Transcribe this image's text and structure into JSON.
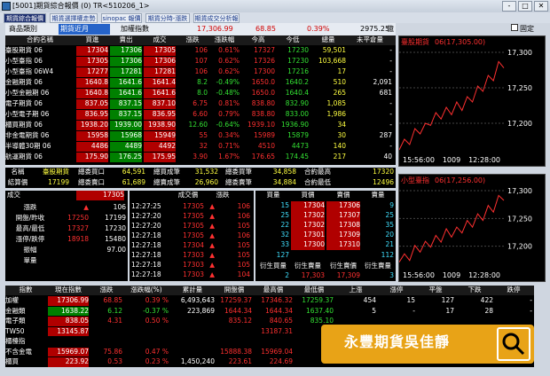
{
  "window": {
    "title": "[5001]期貨綜合報價 (0) TR<510206_1>",
    "btns": [
      "-",
      "□",
      "✕"
    ]
  },
  "tabs": [
    "期貨綜合報價",
    "期貨選擇權走勢",
    "sinopac 報價",
    "期貨分時-漲跌",
    "期貨成交分析報價"
  ],
  "toolbar": {
    "type_label": "商品類別",
    "type_value": "期貨近月",
    "idx_label": "加權指數",
    "idx_value": "17,306.99",
    "idx_chg": "68.85",
    "idx_pct": "0.39%",
    "vol": "2975.25",
    "unit": "億",
    "pin_label": "固定"
  },
  "quote_headers": [
    "合約名稱",
    "買進",
    "賣出",
    "成交",
    "漲跌",
    "漲跌幅",
    "今高",
    "今低",
    "總量",
    "未平倉量"
  ],
  "quotes": [
    [
      "臺股期貨 06",
      "17304",
      "17306",
      "17305",
      "106",
      "0.61%",
      "17327",
      "17230",
      "59,501",
      "-"
    ],
    [
      "小型臺指 06",
      "17305",
      "17306",
      "17306",
      "107",
      "0.62%",
      "17326",
      "17230",
      "103,668",
      "-"
    ],
    [
      "小型臺指 06W4",
      "17277",
      "17281",
      "17281",
      "106",
      "0.62%",
      "17300",
      "17216",
      "17",
      "-"
    ],
    [
      "金融期貨 06",
      "1640.8",
      "1641.6",
      "1641.4",
      "8.2",
      "-0.49%",
      "1650.0",
      "1640.2",
      "510",
      "2,091"
    ],
    [
      "小型金融期 06",
      "1640.8",
      "1641.6",
      "1641.6",
      "8.0",
      "-0.48%",
      "1650.0",
      "1640.4",
      "265",
      "681"
    ],
    [
      "電子期貨 06",
      "837.05",
      "837.15",
      "837.10",
      "6.75",
      "0.81%",
      "838.80",
      "832.90",
      "1,085",
      "-"
    ],
    [
      "小型電子期 06",
      "836.95",
      "837.15",
      "836.95",
      "6.60",
      "0.79%",
      "838.80",
      "833.00",
      "1,986",
      "-"
    ],
    [
      "櫃買期貨 06",
      "1938.20",
      "1939.00",
      "1938.90",
      "12.60",
      "-0.64%",
      "1939.10",
      "1936.90",
      "34",
      "-"
    ],
    [
      "非金電期貨 06",
      "15958",
      "15968",
      "15949",
      "55",
      "0.34%",
      "15989",
      "15879",
      "30",
      "287"
    ],
    [
      "半導體30期 06",
      "4486",
      "4489",
      "4492",
      "32",
      "0.71%",
      "4510",
      "4473",
      "140",
      "-"
    ],
    [
      "航運期貨 06",
      "175.90",
      "176.25",
      "175.95",
      "3.90",
      "1.67%",
      "176.65",
      "174.45",
      "217",
      "40"
    ]
  ],
  "summary": [
    [
      "名稱",
      "臺股期貨",
      "總委買口",
      "64,591",
      "總買成筆",
      "31,532",
      "總委買筆",
      "34,858",
      "合約最高",
      "17320"
    ],
    [
      "結算價",
      "17199",
      "總委賣口",
      "61,689",
      "總賣成筆",
      "26,960",
      "總委賣筆",
      "34,884",
      "合約最低",
      "12496"
    ]
  ],
  "left_detail": {
    "title": "成交",
    "val": "17305",
    "rows": [
      [
        "漲跌",
        "▲",
        "106"
      ],
      [
        "開盤/昨收",
        "17250",
        "17199"
      ],
      [
        "最高/最低",
        "17327",
        "17230"
      ],
      [
        "漲停/跌停",
        "18918",
        "15480"
      ],
      [
        "振幅",
        "",
        "97.00"
      ],
      [
        "單量",
        "",
        ""
      ]
    ]
  },
  "ticks": {
    "hdr": [
      "成交價",
      "漲跌",
      ""
    ],
    "rows": [
      [
        "12:27:25",
        "17305",
        "▲",
        "106"
      ],
      [
        "12:27:20",
        "17305",
        "▲",
        "106"
      ],
      [
        "12:27:20",
        "17305",
        "▲",
        "105"
      ],
      [
        "12:27:18",
        "17305",
        "▲",
        "106"
      ],
      [
        "12:27:18",
        "17304",
        "▲",
        "105"
      ],
      [
        "12:27:18",
        "17303",
        "▲",
        "105"
      ],
      [
        "12:27:18",
        "17303",
        "▲",
        "105"
      ],
      [
        "12:27:18",
        "17303",
        "▲",
        "104"
      ]
    ]
  },
  "book": {
    "hdr": [
      "買量",
      "買價",
      "賣價",
      "賣量"
    ],
    "rows": [
      [
        "15",
        "17304",
        "17306",
        "9"
      ],
      [
        "25",
        "17302",
        "17307",
        "25"
      ],
      [
        "22",
        "17302",
        "17308",
        "35"
      ],
      [
        "32",
        "17301",
        "17309",
        "20"
      ],
      [
        "33",
        "17300",
        "17310",
        "21"
      ]
    ],
    "totals": [
      "127",
      "112"
    ],
    "labels": [
      "衍生買量",
      "衍生賣量",
      "衍生賣價",
      "衍生賣量"
    ],
    "vals": [
      "2",
      "17,303",
      "17,309",
      "3"
    ]
  },
  "index_headers": [
    "指數",
    "現在指數",
    "漲跌",
    "漲跌幅(%)",
    "累計量",
    "開盤價",
    "最高價",
    "最低價",
    "上漲",
    "漲停",
    "平盤",
    "下跌",
    "跌停"
  ],
  "indices": [
    [
      "加權",
      "17306.99",
      "68.85",
      "0.39 %",
      "6,493,643",
      "17259.37",
      "17346.32",
      "17259.37",
      "454",
      "15",
      "127",
      "422",
      "-"
    ],
    [
      "金融類",
      "1638.22",
      "6.12",
      "-0.37 %",
      "223,869",
      "1644.34",
      "1644.34",
      "1637.40",
      "5",
      "-",
      "17",
      "28",
      "-"
    ],
    [
      "電子類",
      "838.05",
      "4.31",
      "0.50 %",
      "",
      "835.12",
      "840.65",
      "835.10",
      "",
      "",
      "",
      "",
      ""
    ],
    [
      "TW50",
      "13145.87",
      "",
      "",
      "",
      "",
      "13187.31",
      "",
      "",
      "",
      "",
      "",
      ""
    ],
    [
      "櫃檯指",
      "",
      "",
      "",
      "",
      "",
      "",
      "",
      "",
      "",
      "",
      "",
      ""
    ],
    [
      "不含金電",
      "15969.07",
      "75.86",
      "0.47 %",
      "",
      "15888.38",
      "15969.04",
      "",
      "",
      "",
      "",
      "",
      ""
    ],
    [
      "櫃買",
      "223.92",
      "0.53",
      "0.23 %",
      "1,450,240",
      "223.61",
      "224.69",
      "",
      "",
      "",
      "",
      "",
      ""
    ]
  ],
  "chart1": {
    "label": "臺股期貨",
    "info": "06(17,305.00)",
    "ticks": [
      "17,300",
      "17,250",
      "17,200"
    ],
    "xticks": [
      "15:56:00",
      "1009",
      "12:28:00"
    ]
  },
  "chart2": {
    "label": "小型臺指",
    "info": "06(17,256.00)",
    "ticks": [
      "17,300",
      "17,250",
      "17,200"
    ],
    "xticks": [
      "15:56:00",
      "1009",
      "12:28:00"
    ]
  },
  "overlay": {
    "text": "永豐期貨吳佳靜"
  }
}
